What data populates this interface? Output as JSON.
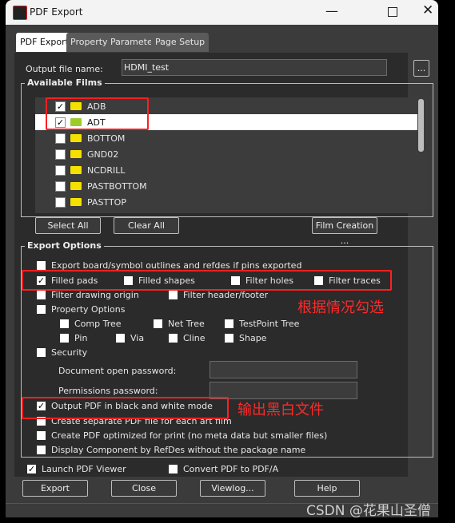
{
  "window": {
    "title": "PDF Export",
    "icon": "app-logo-icon"
  },
  "tabs": [
    {
      "label": "PDF Export",
      "active": true
    },
    {
      "label": "Property Parameters"
    },
    {
      "label": "Page Setup"
    }
  ],
  "output": {
    "label": "Output file name:",
    "value": "HDMI_test",
    "browse": "..."
  },
  "films": {
    "title": "Available Films",
    "items": [
      {
        "name": "ADB",
        "checked": true
      },
      {
        "name": "ADT",
        "checked": true,
        "selected": true
      },
      {
        "name": "BOTTOM",
        "checked": false
      },
      {
        "name": "GND02",
        "checked": false
      },
      {
        "name": "NCDRILL",
        "checked": false
      },
      {
        "name": "PASTBOTTOM",
        "checked": false
      },
      {
        "name": "PASTTOP",
        "checked": false
      }
    ],
    "select_all": "Select All",
    "clear_all": "Clear All",
    "film_creation": "Film Creation ..."
  },
  "export_options": {
    "title": "Export Options",
    "export_outlines": "Export board/symbol outlines and refdes if pins exported",
    "filled_pads": "Filled pads",
    "filled_shapes": "Filled shapes",
    "filter_holes": "Filter holes",
    "filter_traces": "Filter traces",
    "filter_origin": "Filter drawing origin",
    "filter_header": "Filter header/footer",
    "property_options": "Property Options",
    "comp_tree": "Comp Tree",
    "net_tree": "Net Tree",
    "testpoint_tree": "TestPoint Tree",
    "pin": "Pin",
    "via": "Via",
    "cline": "Cline",
    "shape": "Shape",
    "security": "Security",
    "doc_password": "Document open password:",
    "perm_password": "Permissions password:",
    "bw_mode": "Output PDF in black and white mode",
    "separate": "Create separate PDF file for each art film",
    "optimized": "Create PDF optimized for print (no meta data but smaller files)",
    "display_refdes": "Display Component by RefDes without the package name"
  },
  "launch_viewer": "Launch PDF Viewer",
  "convert_pdfa": "Convert PDF to PDF/A",
  "buttons": {
    "export": "Export",
    "close": "Close",
    "viewlog": "Viewlog...",
    "help": "Help"
  },
  "annotations": {
    "note1": "根据情况勾选",
    "note2": "输出黑白文件",
    "color": "#ff2a2a"
  },
  "watermark": "CSDN @花果山圣僧"
}
